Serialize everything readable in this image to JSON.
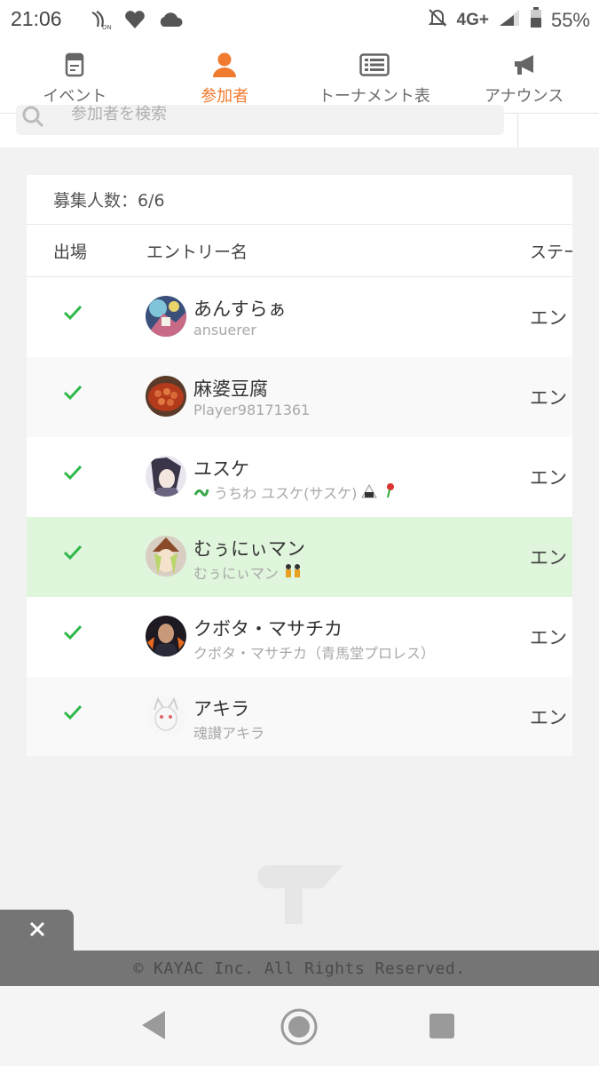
{
  "status_bar": {
    "time": "21:06",
    "network": "4G+",
    "battery": "55%"
  },
  "tabs": [
    {
      "label": "イベント",
      "icon": "event-icon"
    },
    {
      "label": "参加者",
      "icon": "participant-icon",
      "active": true
    },
    {
      "label": "トーナメント表",
      "icon": "bracket-icon"
    },
    {
      "label": "アナウンス",
      "icon": "megaphone-icon"
    }
  ],
  "search": {
    "placeholder": "参加者を検索"
  },
  "entries": {
    "recruit_label": "募集人数：6/6",
    "headers": {
      "appearance": "出場",
      "entry_name": "エントリー名",
      "status": "ステー"
    },
    "rows": [
      {
        "name": "あんすらぁ",
        "sub": "ansuerer",
        "status": "エン",
        "checked": true
      },
      {
        "name": "麻婆豆腐",
        "sub": "Player98171361",
        "status": "エン",
        "checked": true
      },
      {
        "name": "ユスケ",
        "sub": "うちわ ユスケ(サスケ)",
        "status": "エン",
        "checked": true
      },
      {
        "name": "むぅにぃマン",
        "sub": "むぅにぃマン",
        "status": "エン",
        "checked": true,
        "highlighted": true
      },
      {
        "name": "クボタ・マサチカ",
        "sub": "クボタ・マサチカ（青馬堂プロレス）",
        "status": "エン",
        "checked": true
      },
      {
        "name": "アキラ",
        "sub": "魂讃アキラ",
        "status": "エン",
        "checked": true
      }
    ]
  },
  "footer": {
    "copyright": "© KAYAC Inc. All Rights Reserved."
  },
  "colors": {
    "accent": "#f07a2e",
    "check": "#2fb84a",
    "highlight_row": "#dff5dc"
  }
}
